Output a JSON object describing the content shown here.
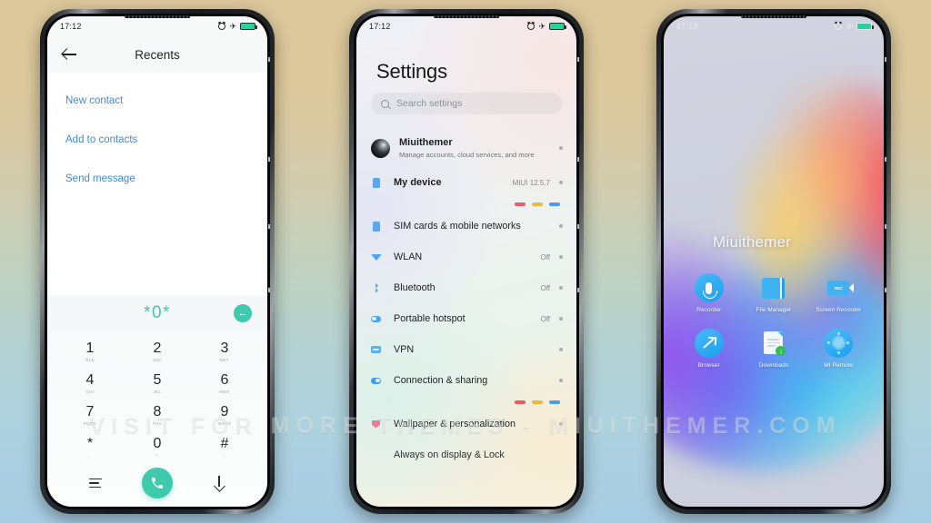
{
  "statusbar": {
    "time": "17:12"
  },
  "phone1": {
    "appbar": {
      "back": "back",
      "title": "Recents"
    },
    "options": [
      {
        "label": "New contact"
      },
      {
        "label": "Add to contacts"
      },
      {
        "label": "Send message"
      }
    ],
    "dialed_number": "*0*",
    "keys": [
      {
        "num": "1",
        "sub": "OLD"
      },
      {
        "num": "2",
        "sub": "ABC"
      },
      {
        "num": "3",
        "sub": "DEF"
      },
      {
        "num": "4",
        "sub": "GHI"
      },
      {
        "num": "5",
        "sub": "JKL"
      },
      {
        "num": "6",
        "sub": "MNO"
      },
      {
        "num": "7",
        "sub": "PQRS"
      },
      {
        "num": "8",
        "sub": "TUV"
      },
      {
        "num": "9",
        "sub": "WXYZ"
      },
      {
        "num": "*",
        "sub": ","
      },
      {
        "num": "0",
        "sub": "+"
      },
      {
        "num": "#",
        "sub": ";"
      }
    ],
    "nav": {
      "menu": "menu",
      "call": "call",
      "hide": "hide-keypad"
    }
  },
  "phone2": {
    "title": "Settings",
    "search_placeholder": "Search settings",
    "account": {
      "name": "Miuithemer",
      "desc": "Manage accounts, cloud services, and more"
    },
    "rows": [
      {
        "label": "My device",
        "value": "MIUI 12.5.7",
        "icon": "sim-icon"
      },
      {
        "label": "SIM cards & mobile networks",
        "value": "",
        "icon": "sim-icon"
      },
      {
        "label": "WLAN",
        "value": "Off",
        "icon": "wlan-icon"
      },
      {
        "label": "Bluetooth",
        "value": "Off",
        "icon": "bluetooth-icon"
      },
      {
        "label": "Portable hotspot",
        "value": "Off",
        "icon": "hotspot-icon"
      },
      {
        "label": "VPN",
        "value": "",
        "icon": "vpn-icon"
      },
      {
        "label": "Connection & sharing",
        "value": "",
        "icon": "sharing-icon"
      },
      {
        "label": "Wallpaper & personalization",
        "value": "",
        "icon": "wallpaper-icon"
      },
      {
        "label": "Always on display & Lock",
        "value": "",
        "icon": "lock-icon"
      }
    ],
    "dot_colors": [
      "#ee5a63",
      "#f3b63c",
      "#4b9bf0"
    ]
  },
  "phone3": {
    "brand": "Miuithemer",
    "apps": [
      {
        "label": "Recorder",
        "icon": "microphone-icon"
      },
      {
        "label": "File Manager",
        "icon": "folder-icon"
      },
      {
        "label": "Screen Recorder",
        "icon": "screen-record-icon"
      },
      {
        "label": "Browser",
        "icon": "compass-icon"
      },
      {
        "label": "Downloads",
        "icon": "download-document-icon"
      },
      {
        "label": "MI Remote",
        "icon": "remote-control-icon"
      }
    ],
    "rec_label": "REC",
    "download_badge": "↓"
  },
  "watermark": "VISIT FOR MORE THEMES - MIUITHEMER.COM"
}
